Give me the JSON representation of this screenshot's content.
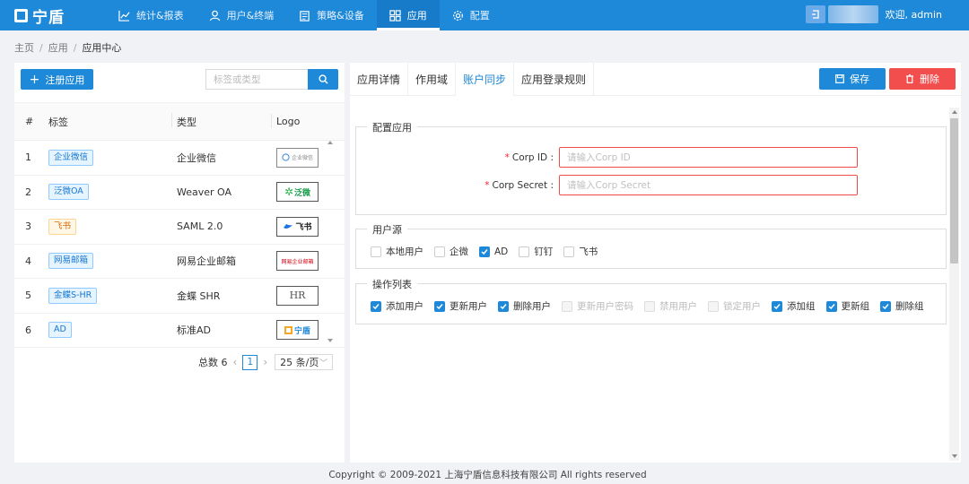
{
  "brand": {
    "name": "宁盾"
  },
  "nav": [
    {
      "label": "统计&报表",
      "icon": "chart-line-icon"
    },
    {
      "label": "用户&终端",
      "icon": "user-icon"
    },
    {
      "label": "策略&设备",
      "icon": "policy-icon"
    },
    {
      "label": "应用",
      "icon": "grid-icon",
      "active": true
    },
    {
      "label": "配置",
      "icon": "gear-icon"
    }
  ],
  "user": {
    "welcome": "欢迎, admin"
  },
  "breadcrumb": {
    "home": "主页",
    "level1": "应用",
    "current": "应用中心"
  },
  "left": {
    "register_label": "注册应用",
    "search_placeholder": "标签或类型",
    "columns": {
      "no": "#",
      "tag": "标签",
      "type": "类型",
      "logo": "Logo"
    },
    "rows": [
      {
        "no": "1",
        "tag": "企业微信",
        "type": "企业微信",
        "logo": "企业微信"
      },
      {
        "no": "2",
        "tag": "泛微OA",
        "type": "Weaver OA",
        "logo": "泛微"
      },
      {
        "no": "3",
        "tag": "飞书",
        "type": "SAML 2.0",
        "logo": "飞书"
      },
      {
        "no": "4",
        "tag": "网易邮箱",
        "type": "网易企业邮箱",
        "logo": "网易企业邮箱"
      },
      {
        "no": "5",
        "tag": "金蝶S-HR",
        "type": "金蝶 SHR",
        "logo": "HR"
      },
      {
        "no": "6",
        "tag": "AD",
        "type": "标准AD",
        "logo": "宁盾"
      }
    ],
    "pager": {
      "total": "总数 6",
      "page": "1",
      "size": "25 条/页"
    }
  },
  "right": {
    "tabs": [
      "应用详情",
      "作用域",
      "账户同步",
      "应用登录规则"
    ],
    "active_tab": "账户同步",
    "save_label": "保存",
    "delete_label": "删除",
    "config": {
      "legend": "配置应用",
      "corp_id_label": "Corp ID :",
      "corp_id_placeholder": "请输入Corp ID",
      "corp_secret_label": "Corp Secret :",
      "corp_secret_placeholder": "请输入Corp Secret"
    },
    "sources": {
      "legend": "用户源",
      "items": [
        {
          "label": "本地用户",
          "checked": false
        },
        {
          "label": "企微",
          "checked": false
        },
        {
          "label": "AD",
          "checked": true
        },
        {
          "label": "钉钉",
          "checked": false
        },
        {
          "label": "飞书",
          "checked": false
        }
      ]
    },
    "operations": {
      "legend": "操作列表",
      "items": [
        {
          "label": "添加用户",
          "checked": true,
          "disabled": false
        },
        {
          "label": "更新用户",
          "checked": true,
          "disabled": false
        },
        {
          "label": "删除用户",
          "checked": true,
          "disabled": false
        },
        {
          "label": "更新用户密码",
          "checked": false,
          "disabled": true
        },
        {
          "label": "禁用用户",
          "checked": false,
          "disabled": true
        },
        {
          "label": "锁定用户",
          "checked": false,
          "disabled": true
        },
        {
          "label": "添加组",
          "checked": true,
          "disabled": false
        },
        {
          "label": "更新组",
          "checked": true,
          "disabled": false
        },
        {
          "label": "删除组",
          "checked": true,
          "disabled": false
        }
      ]
    }
  },
  "footer": "Copyright © 2009-2021 上海宁盾信息科技有限公司 All rights reserved",
  "colors": {
    "primary": "#1e88d9",
    "danger": "#f24e4e"
  }
}
